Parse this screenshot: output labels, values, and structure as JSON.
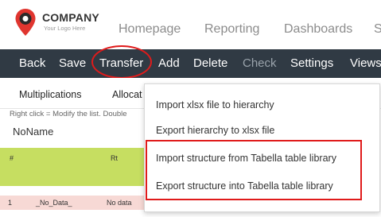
{
  "brand": {
    "name": "COMPANY",
    "tagline": "Your Logo Here",
    "pin_color": "#e0352f",
    "pin_inner_color": "#2a2a2a"
  },
  "topnav": [
    "Homepage",
    "Reporting",
    "Dashboards",
    "S"
  ],
  "toolbar": {
    "items": [
      {
        "label": "Back",
        "enabled": true
      },
      {
        "label": "Save",
        "enabled": true
      },
      {
        "label": "Transfer",
        "enabled": true,
        "annotated": true
      },
      {
        "label": "Add",
        "enabled": true
      },
      {
        "label": "Delete",
        "enabled": true
      },
      {
        "label": "Check",
        "enabled": false
      },
      {
        "label": "Settings",
        "enabled": true
      },
      {
        "label": "Views",
        "enabled": true
      }
    ],
    "background": "#303a44"
  },
  "subtabs": [
    "Multiplications",
    "Allocat"
  ],
  "hint_text": "Right click = Modify the list. Double",
  "column_header": "NoName",
  "grid": {
    "header_cells": [
      "#",
      "Rt"
    ],
    "row": [
      "1",
      "_No_Data_",
      "No data"
    ],
    "header_color": "#c6de61",
    "row_color": "#f7d9d5"
  },
  "dropdown": {
    "items": [
      "Import xlsx file to hierarchy",
      "Export hierarchy to xlsx file",
      "Import structure from Tabella table library",
      "Export structure into Tabella table library"
    ]
  },
  "annotation_color": "#e01b1b"
}
